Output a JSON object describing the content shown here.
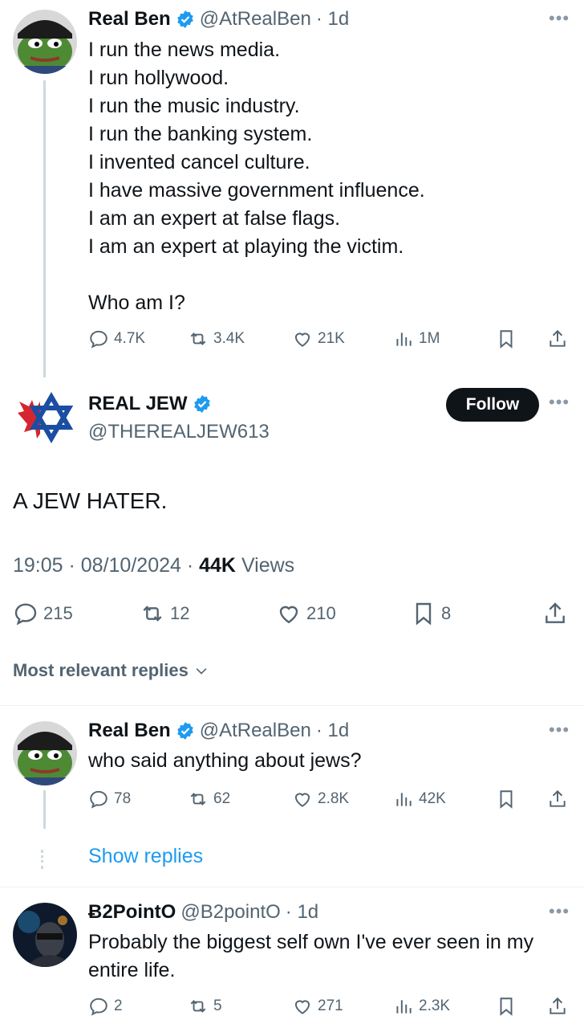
{
  "tweet1": {
    "name": "Real Ben",
    "handle": "@AtRealBen",
    "time": "· 1d",
    "lines": [
      "I run the news media.",
      "I run hollywood.",
      "I run the music industry.",
      "I run the banking system.",
      "I invented cancel culture.",
      "I have massive government influence.",
      "I am an expert at false flags.",
      "I am an expert at playing the victim."
    ],
    "question": "Who am I?",
    "replies": "4.7K",
    "reposts": "3.4K",
    "likes": "21K",
    "views": "1M"
  },
  "main": {
    "name": "REAL JEW",
    "handle": "@THEREALJEW613",
    "follow_label": "Follow",
    "text": "A JEW HATER.",
    "timestamp": "19:05 · 08/10/2024 · ",
    "views_count": "44K",
    "views_label": " Views",
    "replies": "215",
    "reposts": "12",
    "likes": "210",
    "bookmarks": "8"
  },
  "sort_label": "Most relevant replies",
  "reply1": {
    "name": "Real Ben",
    "handle": "@AtRealBen",
    "time": "· 1d",
    "text": "who said anything about jews?",
    "replies": "78",
    "reposts": "62",
    "likes": "2.8K",
    "views": "42K",
    "show_replies": "Show replies"
  },
  "reply2": {
    "name": "Ƀ2PointO",
    "handle": "@B2pointO",
    "time": "· 1d",
    "lines": [
      "Probably the biggest self own I've ever seen in my",
      "entire life."
    ],
    "replies": "2",
    "reposts": "5",
    "likes": "271",
    "views": "2.3K"
  },
  "colors": {
    "accent": "#1d9bf0",
    "text": "#0f1419",
    "muted": "#536471",
    "frog": "#4e8a34"
  }
}
